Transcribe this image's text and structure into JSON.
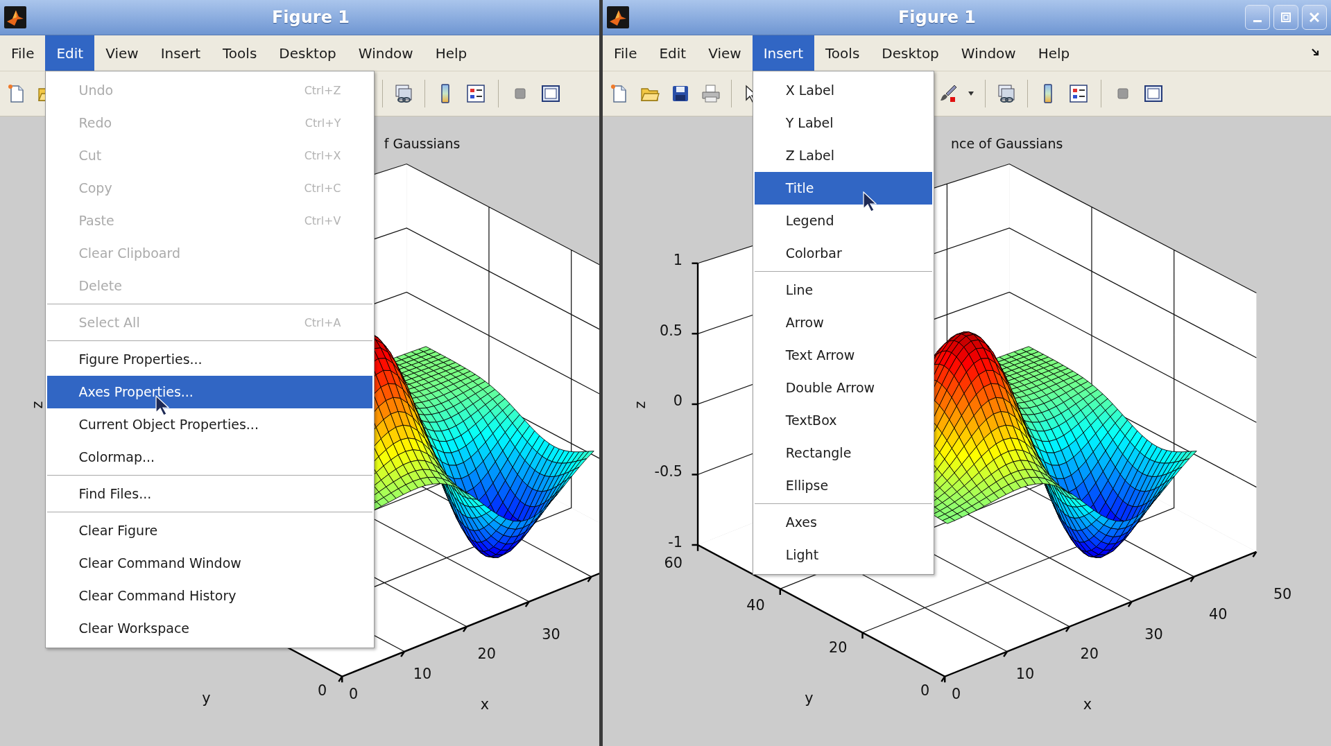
{
  "windows": [
    {
      "title": "Figure 1",
      "window_controls": false,
      "undock_button": false,
      "menubar": [
        {
          "label": "File",
          "selected": false
        },
        {
          "label": "Edit",
          "selected": true
        },
        {
          "label": "View",
          "selected": false
        },
        {
          "label": "Insert",
          "selected": false
        },
        {
          "label": "Tools",
          "selected": false
        },
        {
          "label": "Desktop",
          "selected": false
        },
        {
          "label": "Window",
          "selected": false
        },
        {
          "label": "Help",
          "selected": false
        }
      ],
      "menu": {
        "items": [
          {
            "kind": "item",
            "label": "Undo",
            "shortcut": "Ctrl+Z",
            "disabled": true,
            "selected": false
          },
          {
            "kind": "item",
            "label": "Redo",
            "shortcut": "Ctrl+Y",
            "disabled": true,
            "selected": false
          },
          {
            "kind": "item",
            "label": "Cut",
            "shortcut": "Ctrl+X",
            "disabled": true,
            "selected": false
          },
          {
            "kind": "item",
            "label": "Copy",
            "shortcut": "Ctrl+C",
            "disabled": true,
            "selected": false
          },
          {
            "kind": "item",
            "label": "Paste",
            "shortcut": "Ctrl+V",
            "disabled": true,
            "selected": false
          },
          {
            "kind": "item",
            "label": "Clear Clipboard",
            "disabled": true,
            "selected": false
          },
          {
            "kind": "item",
            "label": "Delete",
            "disabled": true,
            "selected": false
          },
          {
            "kind": "separator"
          },
          {
            "kind": "item",
            "label": "Select All",
            "shortcut": "Ctrl+A",
            "disabled": true,
            "selected": false
          },
          {
            "kind": "separator"
          },
          {
            "kind": "item",
            "label": "Figure Properties...",
            "disabled": false,
            "selected": false
          },
          {
            "kind": "item",
            "label": "Axes Properties...",
            "disabled": false,
            "selected": true
          },
          {
            "kind": "item",
            "label": "Current Object Properties...",
            "disabled": false,
            "selected": false
          },
          {
            "kind": "item",
            "label": "Colormap...",
            "disabled": false,
            "selected": false
          },
          {
            "kind": "separator"
          },
          {
            "kind": "item",
            "label": "Find Files...",
            "disabled": false,
            "selected": false
          },
          {
            "kind": "separator"
          },
          {
            "kind": "item",
            "label": "Clear Figure",
            "disabled": false,
            "selected": false
          },
          {
            "kind": "item",
            "label": "Clear Command Window",
            "disabled": false,
            "selected": false
          },
          {
            "kind": "item",
            "label": "Clear Command History",
            "disabled": false,
            "selected": false
          },
          {
            "kind": "item",
            "label": "Clear Workspace",
            "disabled": false,
            "selected": false
          }
        ]
      },
      "plot": {
        "title": "f Gaussians",
        "z_label": "z",
        "y_label": "y",
        "x_label": "x",
        "y_ticks": [
          "0"
        ],
        "x_ticks": [
          "0",
          "10",
          "20",
          "30"
        ]
      }
    },
    {
      "title": "Figure 1",
      "window_controls": true,
      "undock_button": true,
      "menubar": [
        {
          "label": "File",
          "selected": false
        },
        {
          "label": "Edit",
          "selected": false
        },
        {
          "label": "View",
          "selected": false
        },
        {
          "label": "Insert",
          "selected": true
        },
        {
          "label": "Tools",
          "selected": false
        },
        {
          "label": "Desktop",
          "selected": false
        },
        {
          "label": "Window",
          "selected": false
        },
        {
          "label": "Help",
          "selected": false
        }
      ],
      "menu": {
        "items": [
          {
            "kind": "item",
            "label": "X Label",
            "selected": false
          },
          {
            "kind": "item",
            "label": "Y Label",
            "selected": false
          },
          {
            "kind": "item",
            "label": "Z Label",
            "selected": false
          },
          {
            "kind": "item",
            "label": "Title",
            "selected": true
          },
          {
            "kind": "item",
            "label": "Legend",
            "selected": false
          },
          {
            "kind": "item",
            "label": "Colorbar",
            "selected": false
          },
          {
            "kind": "separator"
          },
          {
            "kind": "item",
            "label": "Line",
            "selected": false
          },
          {
            "kind": "item",
            "label": "Arrow",
            "selected": false
          },
          {
            "kind": "item",
            "label": "Text Arrow",
            "selected": false
          },
          {
            "kind": "item",
            "label": "Double Arrow",
            "selected": false
          },
          {
            "kind": "item",
            "label": "TextBox",
            "selected": false
          },
          {
            "kind": "item",
            "label": "Rectangle",
            "selected": false
          },
          {
            "kind": "item",
            "label": "Ellipse",
            "selected": false
          },
          {
            "kind": "separator"
          },
          {
            "kind": "item",
            "label": "Axes",
            "selected": false
          },
          {
            "kind": "item",
            "label": "Light",
            "selected": false
          }
        ]
      },
      "plot": {
        "title": "nce of Gaussians",
        "z_label": "z",
        "y_label": "y",
        "x_label": "x",
        "z_ticks": [
          "1",
          "0.5",
          "0",
          "-0.5",
          "-1"
        ],
        "y_ticks": [
          "0",
          "20",
          "40",
          "60"
        ],
        "x_ticks": [
          "0",
          "10",
          "20",
          "30",
          "40",
          "50"
        ]
      }
    }
  ]
}
